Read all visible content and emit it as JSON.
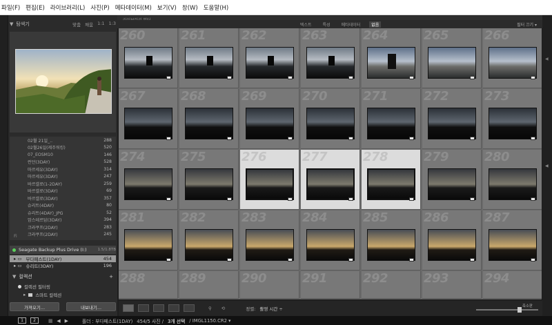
{
  "menu": [
    "파일(F)",
    "편집(E)",
    "라이브러리(L)",
    "사진(P)",
    "메타데이터(M)",
    "보기(V)",
    "창(W)",
    "도움말(H)"
  ],
  "navigator": {
    "title": "탐색기",
    "options": [
      "맞춤",
      "채움",
      "1:1",
      "1:3"
    ]
  },
  "folders": [
    {
      "name": "02월 21일_..",
      "count": "288"
    },
    {
      "name": "02월26일(제주워킹)",
      "count": "520"
    },
    {
      "name": "07_EOSM10",
      "count": "146"
    },
    {
      "name": "런던(3DAY)",
      "count": "528"
    },
    {
      "name": "마르세유(3DAY)",
      "count": "314"
    },
    {
      "name": "마르세유(3DAY)",
      "count": "247"
    },
    {
      "name": "바르셀로(1-2DAY)",
      "count": "259"
    },
    {
      "name": "바르셀로(3DAY)",
      "count": "69"
    },
    {
      "name": "바르셀로(3DAY)",
      "count": "357"
    },
    {
      "name": "슈리트(4DAY)",
      "count": "80"
    },
    {
      "name": "슈리트(4DAY)_JPG",
      "count": "52"
    },
    {
      "name": "암스테르담(3DAY)",
      "count": "394"
    },
    {
      "name": "크라쿠프(2DAY)",
      "count": "283"
    },
    {
      "name": "크라쿠프(2DAY)",
      "count": "245"
    }
  ],
  "fi_label": "Fi",
  "volume": {
    "name": "Seagate Backup Plus Drive (I:)",
    "size": "1.5/1.8TB"
  },
  "volume_folders": [
    {
      "name": "부다페스트(1DAY)",
      "count": "454",
      "selected": true
    },
    {
      "name": "슈리트(3DAY)",
      "count": "196",
      "selected": false
    }
  ],
  "collections": {
    "title": "컬렉션",
    "items": [
      "컬렉션 필터링",
      "스마트 컬렉션"
    ]
  },
  "buttons": {
    "import": "가져오기...",
    "export": "내보내기..."
  },
  "topbar": {
    "label": "라이브러리 필터"
  },
  "filterbar": {
    "tabs": [
      "텍스트",
      "특성",
      "메타데이터",
      "없음"
    ],
    "active_tab": 3,
    "right": "필터 끄기 ▾"
  },
  "grid_numbers": [
    "260",
    "261",
    "262",
    "263",
    "264",
    "265",
    "266",
    "267",
    "268",
    "269",
    "270",
    "271",
    "272",
    "273",
    "274",
    "275",
    "276",
    "277",
    "278",
    "279",
    "280",
    "281",
    "282",
    "283",
    "284",
    "285",
    "286",
    "287",
    "288",
    "289",
    "290",
    "291",
    "292",
    "293",
    "294"
  ],
  "selected_numbers": [
    "276",
    "277",
    "278"
  ],
  "bottombar": {
    "sort_label": "정렬:",
    "sort_value": "촬영 시간 ÷",
    "thumb_label": "축소판"
  },
  "statusbar": {
    "monitor1": "1",
    "monitor2": "2",
    "folder": "폴더 : 부다페스트(1DAY)",
    "count": "454/5 사진 /",
    "selection": "3개 선택",
    "file": "/ IMGL1150.CR2 ▾"
  }
}
